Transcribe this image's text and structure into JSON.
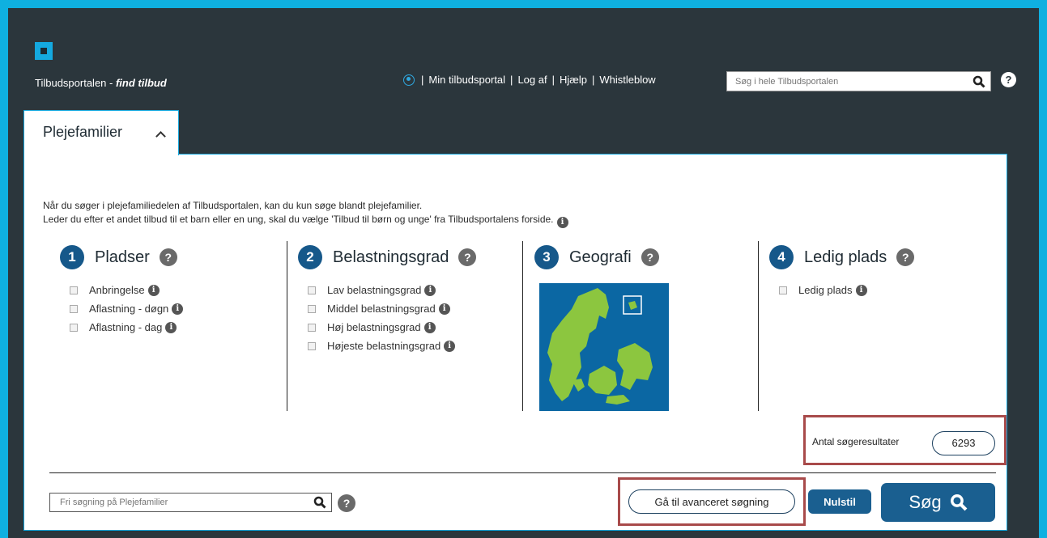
{
  "header": {
    "brand": "Tilbudsportalen - ",
    "brand_em": "find tilbud",
    "nav": [
      "Min tilbudsportal",
      "Log af",
      "Hjælp",
      "Whistleblow"
    ],
    "search_placeholder": "Søg i hele Tilbudsportalen"
  },
  "tab": {
    "label": "Plejefamilier"
  },
  "intro": {
    "line1": "Når du søger i plejefamiliedelen af Tilbudsportalen, kan du kun søge blandt plejefamilier.",
    "line2": "Leder du efter et andet tilbud til et barn eller en ung, skal du vælge 'Tilbud til børn og unge' fra Tilbudsportalens forside."
  },
  "columns": [
    {
      "num": "1",
      "title": "Pladser",
      "options": [
        "Anbringelse",
        "Aflastning - døgn",
        "Aflastning - dag"
      ]
    },
    {
      "num": "2",
      "title": "Belastningsgrad",
      "options": [
        "Lav belastningsgrad",
        "Middel belastningsgrad",
        "Høj belastningsgrad",
        "Højeste belastningsgrad"
      ]
    },
    {
      "num": "3",
      "title": "Geografi",
      "options": []
    },
    {
      "num": "4",
      "title": "Ledig plads",
      "options": [
        "Ledig plads"
      ]
    }
  ],
  "results": {
    "label": "Antal søgeresultater",
    "count": "6293"
  },
  "footer": {
    "free_search_placeholder": "Fri søgning på Plejefamilier",
    "advanced_label": "Gå til avanceret søgning",
    "reset_label": "Nulstil",
    "search_label": "Søg"
  },
  "icons": {
    "info": "i",
    "help": "?"
  },
  "colors": {
    "accent": "#0fb0e0",
    "frame": "#2b363c",
    "primary": "#1a5f90",
    "highlight": "#a84a4a"
  }
}
